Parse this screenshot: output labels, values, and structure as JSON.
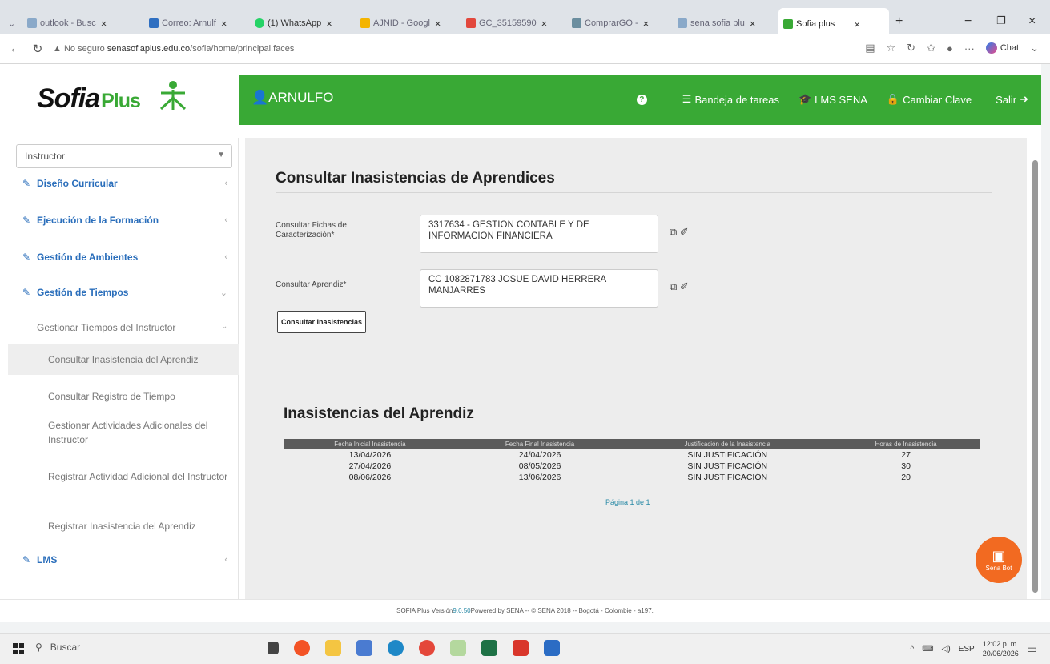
{
  "browser": {
    "tabs": [
      {
        "title": "outlook - Busc",
        "color": "#8aa9c9"
      },
      {
        "title": "Correo: Arnulf",
        "color": "#2f6fc1"
      },
      {
        "title": "(1) WhatsApp",
        "color": "#25d366"
      },
      {
        "title": "AJNID - Googl",
        "color": "#f4b400"
      },
      {
        "title": "GC_35159590",
        "color": "#e2483d"
      },
      {
        "title": "ComprarGO -",
        "color": "#6b8e9f"
      },
      {
        "title": "sena sofia plu",
        "color": "#8aa9c9"
      },
      {
        "title": "Sofia plus",
        "color": "#39a935"
      }
    ],
    "new_tab": "+",
    "min": "−",
    "restore": "❐",
    "close": "×",
    "url_security": "No seguro",
    "url_host": "senasofiaplus.edu.co",
    "url_path": "/sofia/home/principal.faces",
    "chat_label": "Chat"
  },
  "app": {
    "logo_main": "Sofia",
    "logo_sub": "Plus",
    "user": "ARNULFO",
    "nav": [
      {
        "label": "?",
        "icon": "help-icon"
      },
      {
        "label": "Bandeja de tareas",
        "icon": "tray-icon"
      },
      {
        "label": "LMS SENA",
        "icon": "graduation-cap-icon"
      },
      {
        "label": "Cambiar Clave",
        "icon": "lock-icon"
      },
      {
        "label": "Salir",
        "icon": "sign-out-icon"
      }
    ]
  },
  "sidebar": {
    "role": "Instructor",
    "menu": [
      {
        "label": "Diseño Curricular"
      },
      {
        "label": "Ejecución de la Formación"
      },
      {
        "label": "Gestión de Ambientes"
      },
      {
        "label": "Gestión de Tiempos"
      },
      {
        "label": "LMS"
      }
    ],
    "sub_header": "Gestionar Tiempos del Instructor",
    "sub_items": [
      "Consultar Inasistencia del Aprendiz",
      "Consultar Registro de Tiempo",
      "Gestionar Actividades Adicionales del Instructor",
      "Registrar Actividad Adicional del Instructor",
      "Registrar Inasistencia del Aprendiz"
    ]
  },
  "form": {
    "title": "Consultar Inasistencias de Aprendices",
    "ficha_label": "Consultar Fichas de Caracterización*",
    "ficha_value": "3317634 - GESTION CONTABLE Y DE INFORMACION FINANCIERA",
    "aprendiz_label": "Consultar Aprendiz*",
    "aprendiz_value": "CC 1082871783 JOSUE DAVID HERRERA MANJARRES",
    "button": "Consultar Inasistencias"
  },
  "results": {
    "title": "Inasistencias del Aprendiz",
    "columns": [
      "Fecha Inicial Inasistencia",
      "Fecha Final Inasistencia",
      "Justificación de la Inasistencia",
      "Horas de Inasistencia"
    ],
    "rows": [
      [
        "13/04/2026",
        "24/04/2026",
        "SIN JUSTIFICACIÓN",
        "27"
      ],
      [
        "27/04/2026",
        "08/05/2026",
        "SIN JUSTIFICACIÓN",
        "30"
      ],
      [
        "08/06/2026",
        "13/06/2026",
        "SIN JUSTIFICACIÓN",
        "20"
      ]
    ],
    "pager": "Página 1 de 1"
  },
  "chatbot_label": "Sena Bot",
  "footer": {
    "prefix": "SOFIA Plus Versión ",
    "version": "9.0.50",
    "rest": " Powered by SENA -- © SENA 2018 -- Bogotá - Colombie - a197."
  },
  "taskbar": {
    "search_placeholder": "Buscar",
    "lang": "ESP",
    "time": "12:02 p. m.",
    "date": "20/06/2026"
  }
}
